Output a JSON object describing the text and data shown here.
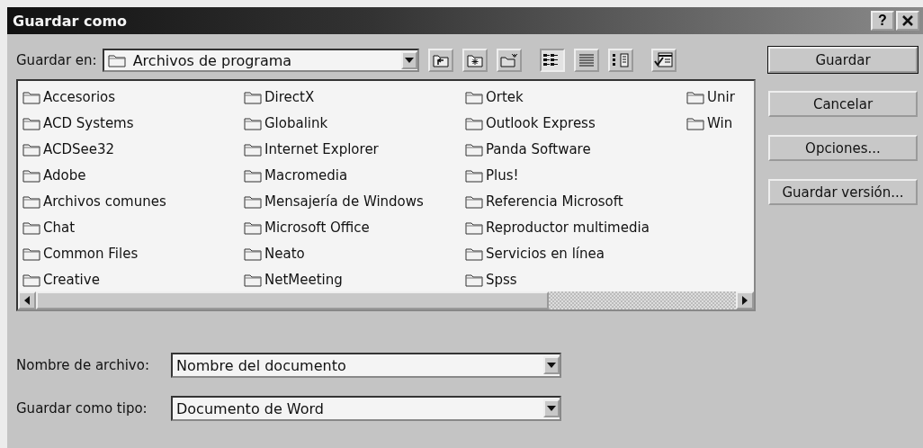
{
  "window": {
    "title": "Guardar como",
    "help_button": "?"
  },
  "location": {
    "label": "Guardar en:",
    "value": "Archivos de programa"
  },
  "toolbar": [
    {
      "kind": "up",
      "selected": false
    },
    {
      "kind": "web",
      "selected": false
    },
    {
      "kind": "new-folder",
      "selected": false
    },
    {
      "kind": "list",
      "selected": true
    },
    {
      "kind": "details",
      "selected": false
    },
    {
      "kind": "properties",
      "selected": false
    },
    {
      "kind": "tools",
      "selected": false
    }
  ],
  "files": [
    {
      "name": "Accesorios"
    },
    {
      "name": "ACD Systems"
    },
    {
      "name": "ACDSee32"
    },
    {
      "name": "Adobe"
    },
    {
      "name": "Archivos comunes"
    },
    {
      "name": "Chat"
    },
    {
      "name": "Common Files"
    },
    {
      "name": "Creative"
    },
    {
      "name": "DirectX"
    },
    {
      "name": "Globalink"
    },
    {
      "name": "Internet Explorer"
    },
    {
      "name": "Macromedia"
    },
    {
      "name": "Mensajería de Windows"
    },
    {
      "name": "Microsoft Office"
    },
    {
      "name": "Neato"
    },
    {
      "name": "NetMeeting"
    },
    {
      "name": "Ortek"
    },
    {
      "name": "Outlook Express"
    },
    {
      "name": "Panda Software"
    },
    {
      "name": "Plus!"
    },
    {
      "name": "Referencia Microsoft"
    },
    {
      "name": "Reproductor multimedia"
    },
    {
      "name": "Servicios en línea"
    },
    {
      "name": "Spss"
    },
    {
      "name": "Unir"
    },
    {
      "name": "Win"
    }
  ],
  "buttons": [
    {
      "label": "Guardar",
      "default": true
    },
    {
      "label": "Cancelar",
      "default": false
    },
    {
      "label": "Opciones...",
      "default": false
    },
    {
      "label": "Guardar versión...",
      "default": false
    }
  ],
  "fields": [
    {
      "label": "Nombre de archivo:",
      "value": "Nombre del documento"
    },
    {
      "label": "Guardar como tipo:",
      "value": "Documento de Word"
    }
  ]
}
